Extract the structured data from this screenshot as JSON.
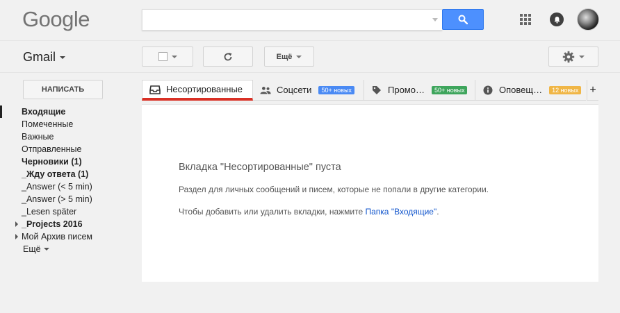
{
  "header": {
    "logo": "Google",
    "search": {
      "value": "",
      "placeholder": ""
    }
  },
  "toolbar": {
    "app_label": "Gmail",
    "more_label": "Ещё"
  },
  "sidebar": {
    "compose_label": "НАПИСАТЬ",
    "items": [
      {
        "label": "Входящие",
        "bold": true
      },
      {
        "label": "Помеченные"
      },
      {
        "label": "Важные"
      },
      {
        "label": "Отправленные"
      },
      {
        "label": "Черновики (1)",
        "bold": true
      },
      {
        "label": "_Жду ответа (1)",
        "bold": true
      },
      {
        "label": "_Answer (< 5 min)"
      },
      {
        "label": "_Answer (> 5 min)"
      },
      {
        "label": "_Lesen später"
      },
      {
        "label": "_Projects 2016",
        "bold": true,
        "expandable": true
      },
      {
        "label": "Мой Архив писем",
        "expandable": true
      }
    ],
    "more_label": "Ещё"
  },
  "tabs": [
    {
      "label": "Несортированные",
      "active": true,
      "icon": "inbox-icon"
    },
    {
      "label": "Соцсети",
      "badge": "50+ новых",
      "badge_color": "#4a8af4",
      "icon": "people-icon"
    },
    {
      "label": "Промо…",
      "badge": "50+ новых",
      "badge_color": "#3ea55c",
      "icon": "tag-icon"
    },
    {
      "label": "Оповещ…",
      "badge": "12 новых",
      "badge_color": "#f0b646",
      "icon": "info-icon"
    }
  ],
  "tab_add_label": "+",
  "main": {
    "empty_title": "Вкладка \"Несортированные\" пуста",
    "empty_desc": "Раздел для личных сообщений и писем, которые не попали в другие категории.",
    "hint_text": "Чтобы добавить или удалить вкладки, нажмите ",
    "hint_link": "Папка \"Входящие\"",
    "hint_end": "."
  },
  "colors": {
    "search_button": "#4d90fe",
    "active_tab_underline": "#d93025",
    "link": "#1155cc"
  }
}
